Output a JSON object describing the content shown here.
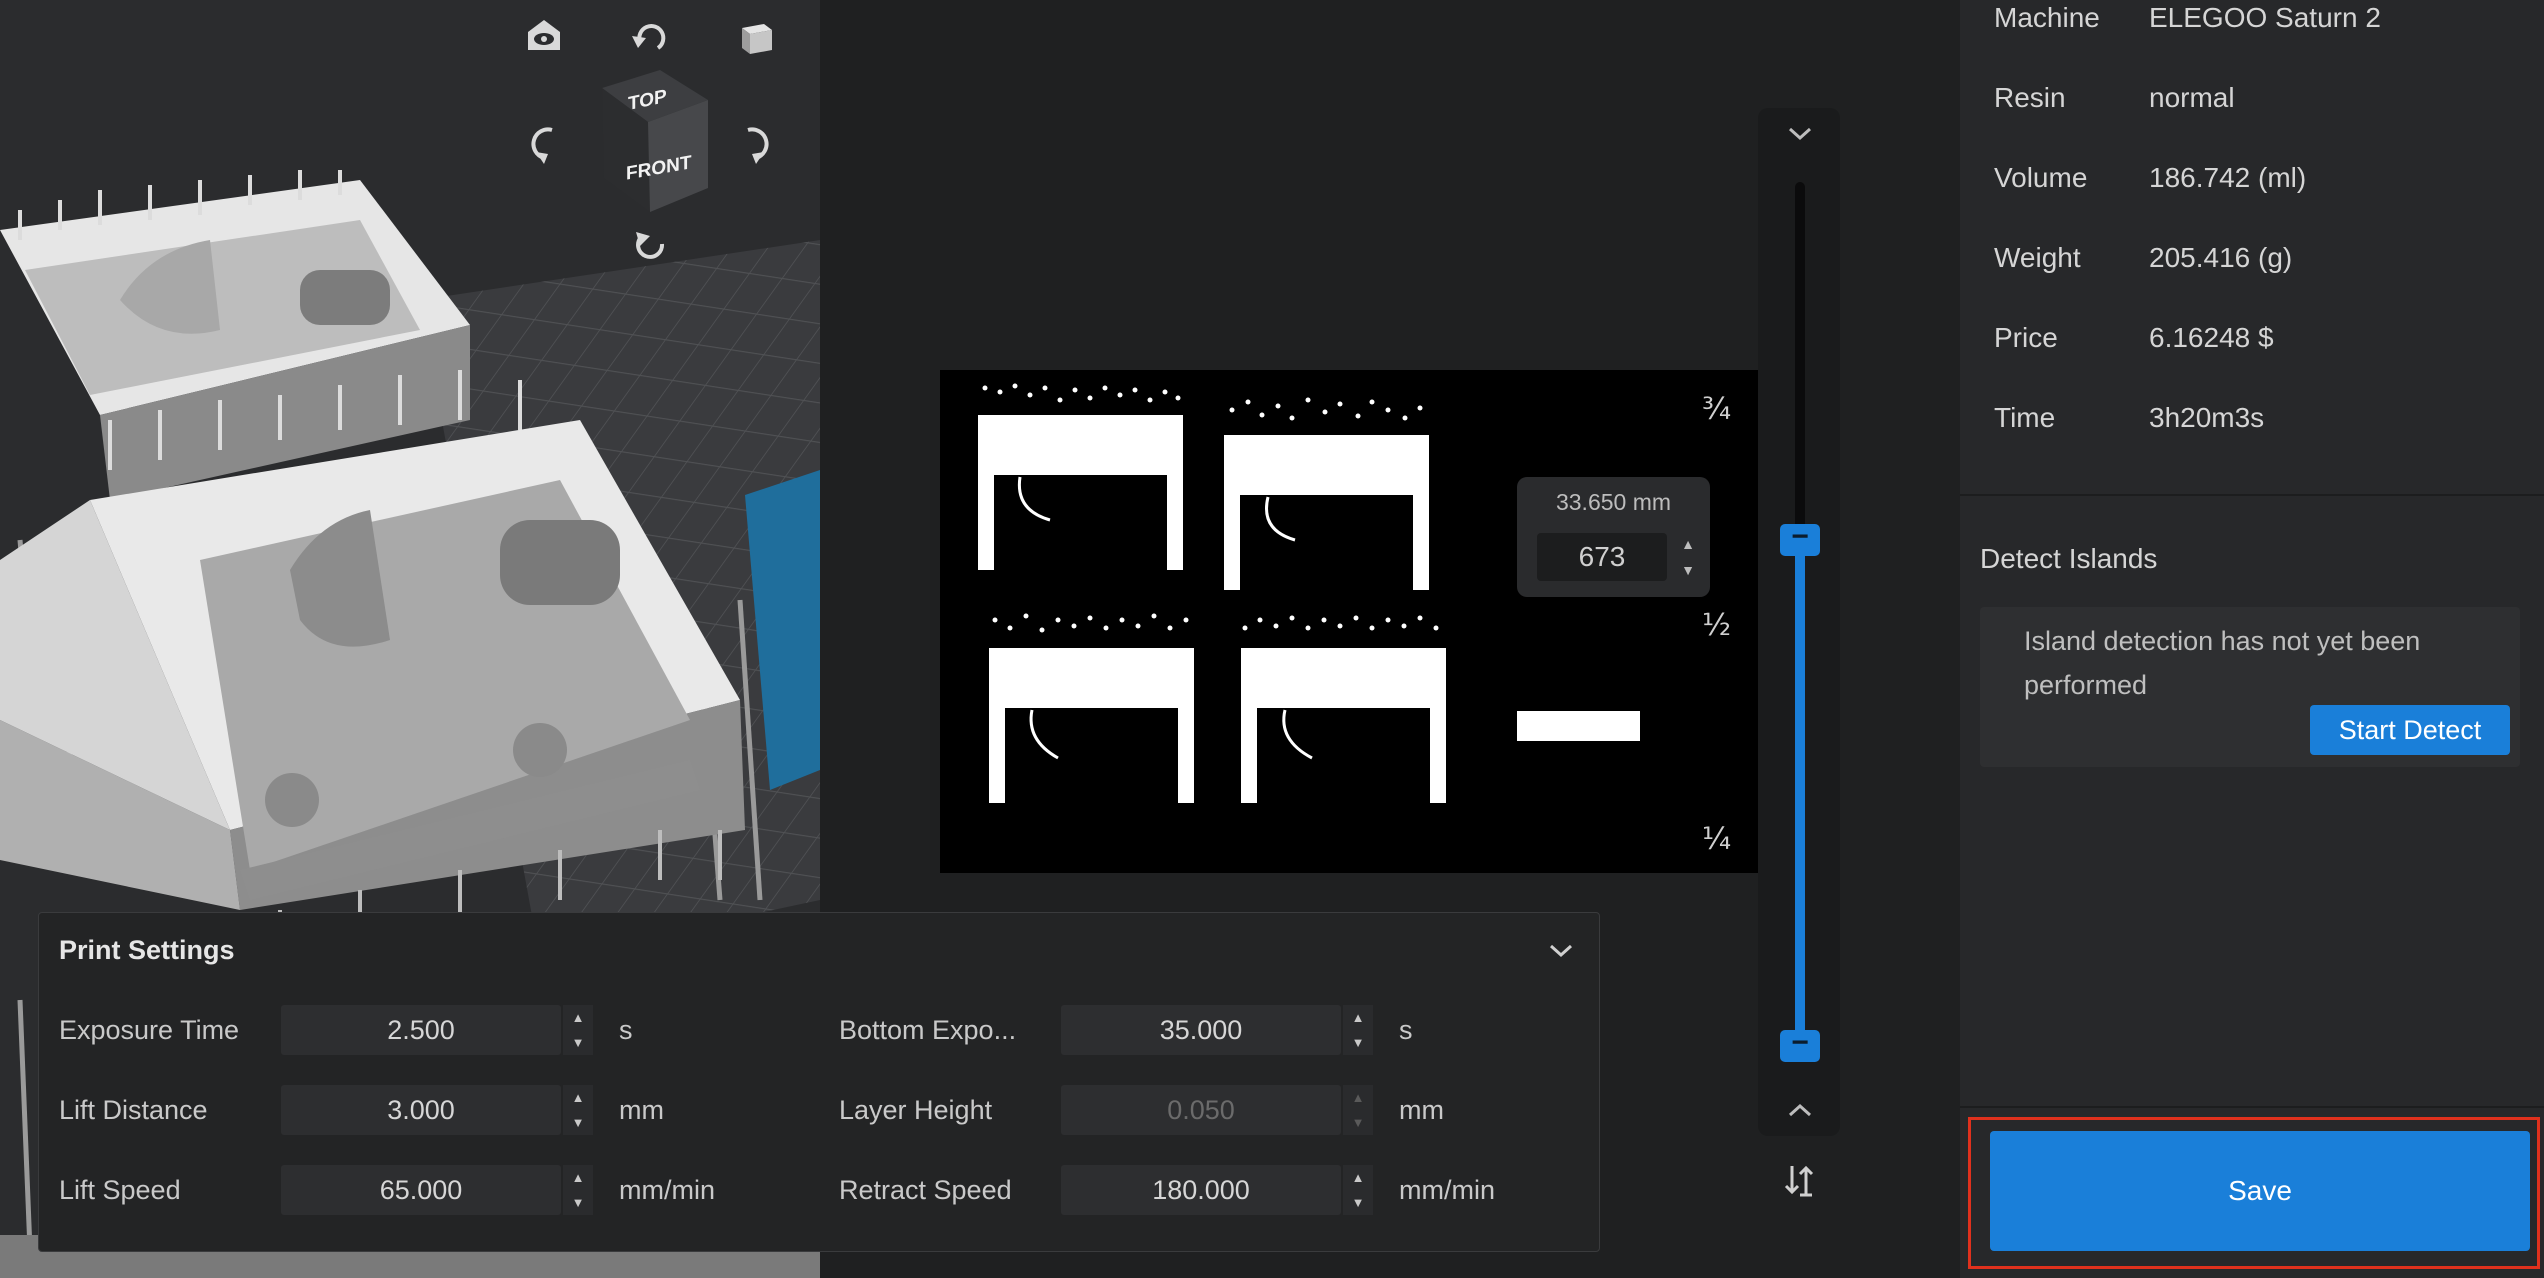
{
  "viewcube": {
    "top_label": "TOP",
    "front_label": "FRONT"
  },
  "preview": {
    "fractions": {
      "three_quarter": "¾",
      "half": "½",
      "quarter": "¼"
    },
    "layer_height_mm": "33.650 mm",
    "layer_index": "673"
  },
  "print_settings": {
    "title": "Print Settings",
    "fields": [
      {
        "label": "Exposure Time",
        "value": "2.500",
        "unit": "s",
        "disabled": false
      },
      {
        "label": "Bottom Expo...",
        "value": "35.000",
        "unit": "s",
        "disabled": false
      },
      {
        "label": "Lift Distance",
        "value": "3.000",
        "unit": "mm",
        "disabled": false
      },
      {
        "label": "Layer Height",
        "value": "0.050",
        "unit": "mm",
        "disabled": true
      },
      {
        "label": "Lift Speed",
        "value": "65.000",
        "unit": "mm/min",
        "disabled": false
      },
      {
        "label": "Retract Speed",
        "value": "180.000",
        "unit": "mm/min",
        "disabled": false
      }
    ]
  },
  "info": {
    "rows": [
      {
        "label": "Machine",
        "value": "ELEGOO Saturn 2"
      },
      {
        "label": "Resin",
        "value": "normal"
      },
      {
        "label": "Volume",
        "value": "186.742 (ml)"
      },
      {
        "label": "Weight",
        "value": "205.416 (g)"
      },
      {
        "label": "Price",
        "value": "6.16248 $"
      },
      {
        "label": "Time",
        "value": "3h20m3s"
      }
    ]
  },
  "detect_islands": {
    "title": "Detect Islands",
    "message": "Island detection has not yet been performed",
    "button": "Start Detect"
  },
  "save_label": "Save",
  "colors": {
    "accent": "#1a7fd9",
    "highlight": "#e0311d"
  }
}
